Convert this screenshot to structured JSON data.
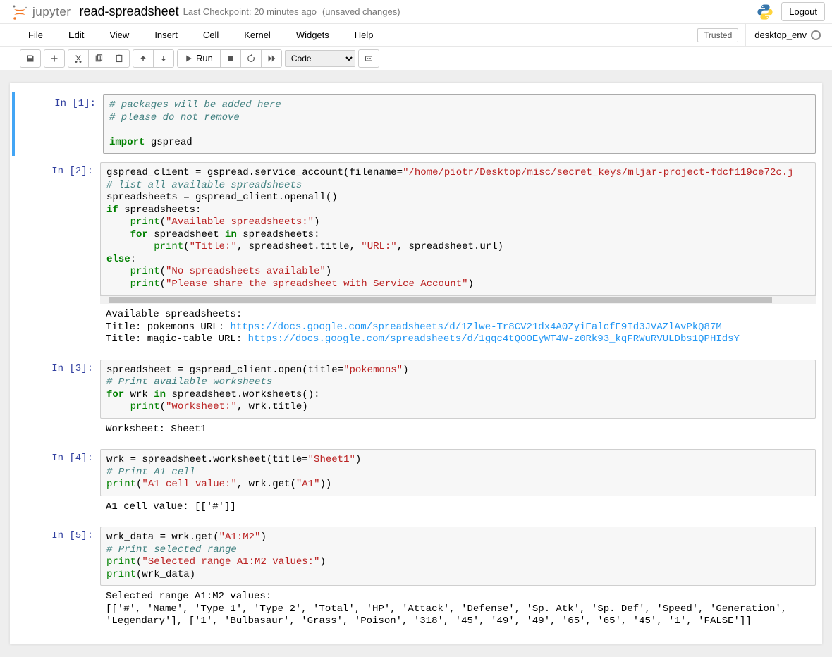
{
  "header": {
    "logo_text": "jupyter",
    "notebook_name": "read-spreadsheet",
    "checkpoint": "Last Checkpoint: 20 minutes ago",
    "unsaved": "(unsaved changes)",
    "logout": "Logout"
  },
  "menus": [
    "File",
    "Edit",
    "View",
    "Insert",
    "Cell",
    "Kernel",
    "Widgets",
    "Help"
  ],
  "trusted": "Trusted",
  "kernel_name": "desktop_env",
  "toolbar": {
    "run_label": "Run",
    "cell_type": "Code"
  },
  "cells": [
    {
      "prompt": "In [1]:",
      "selected": true,
      "lines": [
        [
          {
            "t": "# packages will be added here",
            "c": "c-comment"
          }
        ],
        [
          {
            "t": "# please do not remove",
            "c": "c-comment"
          }
        ],
        [
          {
            "t": ""
          }
        ],
        [
          {
            "t": "import",
            "c": "c-keyword"
          },
          {
            "t": " gspread"
          }
        ]
      ]
    },
    {
      "prompt": "In [2]:",
      "hscroll": true,
      "lines": [
        [
          {
            "t": "gspread_client "
          },
          {
            "t": "="
          },
          {
            "t": " gspread.service_account(filename"
          },
          {
            "t": "="
          },
          {
            "t": "\"/home/piotr/Desktop/misc/secret_keys/mljar-project-fdcf119ce72c.j",
            "c": "c-string"
          }
        ],
        [
          {
            "t": "# list all available spreadsheets",
            "c": "c-comment"
          }
        ],
        [
          {
            "t": "spreadsheets "
          },
          {
            "t": "="
          },
          {
            "t": " gspread_client.openall()"
          }
        ],
        [
          {
            "t": "if",
            "c": "c-keyword"
          },
          {
            "t": " spreadsheets:"
          }
        ],
        [
          {
            "t": "    "
          },
          {
            "t": "print",
            "c": "c-builtin"
          },
          {
            "t": "("
          },
          {
            "t": "\"Available spreadsheets:\"",
            "c": "c-string"
          },
          {
            "t": ")"
          }
        ],
        [
          {
            "t": "    "
          },
          {
            "t": "for",
            "c": "c-keyword"
          },
          {
            "t": " spreadsheet "
          },
          {
            "t": "in",
            "c": "c-keyword"
          },
          {
            "t": " spreadsheets:"
          }
        ],
        [
          {
            "t": "        "
          },
          {
            "t": "print",
            "c": "c-builtin"
          },
          {
            "t": "("
          },
          {
            "t": "\"Title:\"",
            "c": "c-string"
          },
          {
            "t": ", spreadsheet.title, "
          },
          {
            "t": "\"URL:\"",
            "c": "c-string"
          },
          {
            "t": ", spreadsheet.url)"
          }
        ],
        [
          {
            "t": "else",
            "c": "c-keyword"
          },
          {
            "t": ":"
          }
        ],
        [
          {
            "t": "    "
          },
          {
            "t": "print",
            "c": "c-builtin"
          },
          {
            "t": "("
          },
          {
            "t": "\"No spreadsheets available\"",
            "c": "c-string"
          },
          {
            "t": ")"
          }
        ],
        [
          {
            "t": "    "
          },
          {
            "t": "print",
            "c": "c-builtin"
          },
          {
            "t": "("
          },
          {
            "t": "\"Please share the spreadsheet with Service Account\"",
            "c": "c-string"
          },
          {
            "t": ")"
          }
        ]
      ],
      "output": [
        [
          {
            "t": "Available spreadsheets:"
          }
        ],
        [
          {
            "t": "Title: pokemons URL: "
          },
          {
            "t": "https://docs.google.com/spreadsheets/d/1Zlwe-Tr8CV21dx4A0ZyiEalcfE9Id3JVAZlAvPkQ87M",
            "c": "url"
          }
        ],
        [
          {
            "t": "Title: magic-table URL: "
          },
          {
            "t": "https://docs.google.com/spreadsheets/d/1gqc4tQOOEyWT4W-z0Rk93_kqFRWuRVULDbs1QPHIdsY",
            "c": "url"
          }
        ]
      ]
    },
    {
      "prompt": "In [3]:",
      "lines": [
        [
          {
            "t": "spreadsheet "
          },
          {
            "t": "="
          },
          {
            "t": " gspread_client.open(title"
          },
          {
            "t": "="
          },
          {
            "t": "\"pokemons\"",
            "c": "c-string"
          },
          {
            "t": ")"
          }
        ],
        [
          {
            "t": "# Print available worksheets",
            "c": "c-comment"
          }
        ],
        [
          {
            "t": "for",
            "c": "c-keyword"
          },
          {
            "t": " wrk "
          },
          {
            "t": "in",
            "c": "c-keyword"
          },
          {
            "t": " spreadsheet.worksheets():"
          }
        ],
        [
          {
            "t": "    "
          },
          {
            "t": "print",
            "c": "c-builtin"
          },
          {
            "t": "("
          },
          {
            "t": "\"Worksheet:\"",
            "c": "c-string"
          },
          {
            "t": ", wrk.title)"
          }
        ]
      ],
      "output": [
        [
          {
            "t": "Worksheet: Sheet1"
          }
        ]
      ]
    },
    {
      "prompt": "In [4]:",
      "lines": [
        [
          {
            "t": "wrk "
          },
          {
            "t": "="
          },
          {
            "t": " spreadsheet.worksheet(title"
          },
          {
            "t": "="
          },
          {
            "t": "\"Sheet1\"",
            "c": "c-string"
          },
          {
            "t": ")"
          }
        ],
        [
          {
            "t": "# Print A1 cell",
            "c": "c-comment"
          }
        ],
        [
          {
            "t": "print",
            "c": "c-builtin"
          },
          {
            "t": "("
          },
          {
            "t": "\"A1 cell value:\"",
            "c": "c-string"
          },
          {
            "t": ", wrk.get("
          },
          {
            "t": "\"A1\"",
            "c": "c-string"
          },
          {
            "t": "))"
          }
        ]
      ],
      "output": [
        [
          {
            "t": "A1 cell value: [['#']]"
          }
        ]
      ]
    },
    {
      "prompt": "In [5]:",
      "lines": [
        [
          {
            "t": "wrk_data "
          },
          {
            "t": "="
          },
          {
            "t": " wrk.get("
          },
          {
            "t": "\"A1:M2\"",
            "c": "c-string"
          },
          {
            "t": ")"
          }
        ],
        [
          {
            "t": "# Print selected range",
            "c": "c-comment"
          }
        ],
        [
          {
            "t": "print",
            "c": "c-builtin"
          },
          {
            "t": "("
          },
          {
            "t": "\"Selected range A1:M2 values:\"",
            "c": "c-string"
          },
          {
            "t": ")"
          }
        ],
        [
          {
            "t": "print",
            "c": "c-builtin"
          },
          {
            "t": "(wrk_data)"
          }
        ]
      ],
      "output": [
        [
          {
            "t": "Selected range A1:M2 values:"
          }
        ],
        [
          {
            "t": "[['#', 'Name', 'Type 1', 'Type 2', 'Total', 'HP', 'Attack', 'Defense', 'Sp. Atk', 'Sp. Def', 'Speed', 'Generation', 'Legendary'], ['1', 'Bulbasaur', 'Grass', 'Poison', '318', '45', '49', '49', '65', '65', '45', '1', 'FALSE']]"
          }
        ]
      ]
    }
  ]
}
